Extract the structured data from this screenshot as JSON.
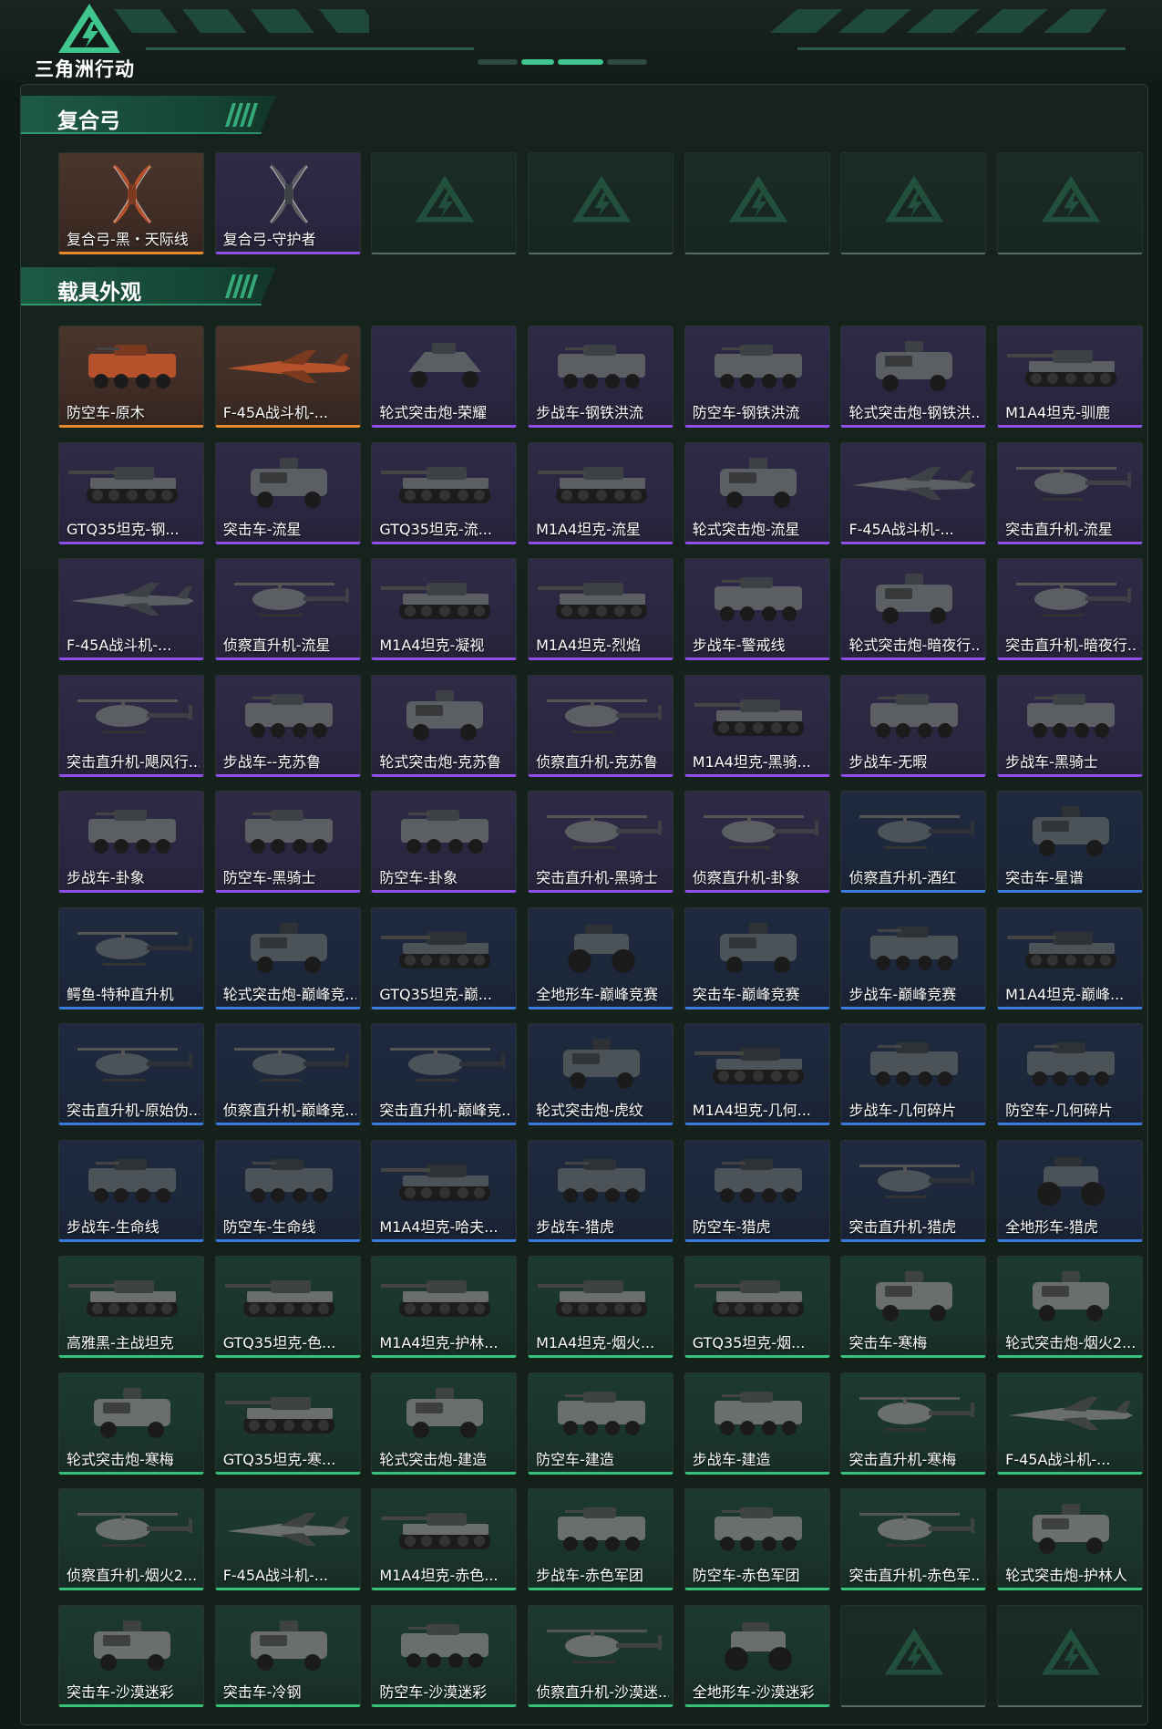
{
  "header": {
    "logo_text": "三角洲行动",
    "accent": "#3fc58d"
  },
  "sections": [
    {
      "title": "复合弓",
      "items": [
        {
          "name": "复合弓-黑・天际线",
          "rarity": "orange",
          "kind": "bow"
        },
        {
          "name": "复合弓-守护者",
          "rarity": "purple",
          "kind": "bow"
        },
        {
          "name": "",
          "rarity": "empty",
          "kind": "empty"
        },
        {
          "name": "",
          "rarity": "empty",
          "kind": "empty"
        },
        {
          "name": "",
          "rarity": "empty",
          "kind": "empty"
        },
        {
          "name": "",
          "rarity": "empty",
          "kind": "empty"
        },
        {
          "name": "",
          "rarity": "empty",
          "kind": "empty"
        }
      ]
    },
    {
      "title": "载具外观",
      "items": [
        {
          "name": "防空车-原木",
          "rarity": "orange",
          "kind": "apc"
        },
        {
          "name": "F-45A战斗机-...",
          "rarity": "orange",
          "kind": "jet"
        },
        {
          "name": "轮式突击炮-荣耀",
          "rarity": "purple",
          "kind": "buggy"
        },
        {
          "name": "步战车-钢铁洪流",
          "rarity": "purple",
          "kind": "apc"
        },
        {
          "name": "防空车-钢铁洪流",
          "rarity": "purple",
          "kind": "apc"
        },
        {
          "name": "轮式突击炮-钢铁洪...",
          "rarity": "purple",
          "kind": "truck"
        },
        {
          "name": "M1A4坦克-驯鹿",
          "rarity": "purple",
          "kind": "tank"
        },
        {
          "name": "GTQ35坦克-钢...",
          "rarity": "purple",
          "kind": "tank"
        },
        {
          "name": "突击车-流星",
          "rarity": "purple",
          "kind": "truck"
        },
        {
          "name": "GTQ35坦克-流...",
          "rarity": "purple",
          "kind": "tank"
        },
        {
          "name": "M1A4坦克-流星",
          "rarity": "purple",
          "kind": "tank"
        },
        {
          "name": "轮式突击炮-流星",
          "rarity": "purple",
          "kind": "truck"
        },
        {
          "name": "F-45A战斗机-...",
          "rarity": "purple",
          "kind": "jet"
        },
        {
          "name": "突击直升机-流星",
          "rarity": "purple",
          "kind": "heli"
        },
        {
          "name": "F-45A战斗机-...",
          "rarity": "purple",
          "kind": "jet"
        },
        {
          "name": "侦察直升机-流星",
          "rarity": "purple",
          "kind": "heli"
        },
        {
          "name": "M1A4坦克-凝视",
          "rarity": "purple",
          "kind": "tank"
        },
        {
          "name": "M1A4坦克-烈焰",
          "rarity": "purple",
          "kind": "tank"
        },
        {
          "name": "步战车-警戒线",
          "rarity": "purple",
          "kind": "apc"
        },
        {
          "name": "轮式突击炮-暗夜行...",
          "rarity": "purple",
          "kind": "truck"
        },
        {
          "name": "突击直升机-暗夜行...",
          "rarity": "purple",
          "kind": "heli"
        },
        {
          "name": "突击直升机-飓风行...",
          "rarity": "purple",
          "kind": "heli"
        },
        {
          "name": "步战车--克苏鲁",
          "rarity": "purple",
          "kind": "apc"
        },
        {
          "name": "轮式突击炮-克苏鲁",
          "rarity": "purple",
          "kind": "truck"
        },
        {
          "name": "侦察直升机-克苏鲁",
          "rarity": "purple",
          "kind": "heli"
        },
        {
          "name": "M1A4坦克-黑骑...",
          "rarity": "purple",
          "kind": "tank"
        },
        {
          "name": "步战车-无暇",
          "rarity": "purple",
          "kind": "apc"
        },
        {
          "name": "步战车-黑骑士",
          "rarity": "purple",
          "kind": "apc"
        },
        {
          "name": "步战车-卦象",
          "rarity": "purple",
          "kind": "apc"
        },
        {
          "name": "防空车-黑骑士",
          "rarity": "purple",
          "kind": "apc"
        },
        {
          "name": "防空车-卦象",
          "rarity": "purple",
          "kind": "apc"
        },
        {
          "name": "突击直升机-黑骑士",
          "rarity": "purple",
          "kind": "heli"
        },
        {
          "name": "侦察直升机-卦象",
          "rarity": "purple",
          "kind": "heli"
        },
        {
          "name": "侦察直升机-酒红",
          "rarity": "blue",
          "kind": "heli"
        },
        {
          "name": "突击车-星谱",
          "rarity": "blue",
          "kind": "truck"
        },
        {
          "name": "鳄鱼-特种直升机",
          "rarity": "blue",
          "kind": "heli"
        },
        {
          "name": "轮式突击炮-巅峰竞...",
          "rarity": "blue",
          "kind": "truck"
        },
        {
          "name": "GTQ35坦克-巅...",
          "rarity": "blue",
          "kind": "tank"
        },
        {
          "name": "全地形车-巅峰竞赛",
          "rarity": "blue",
          "kind": "atv"
        },
        {
          "name": "突击车-巅峰竞赛",
          "rarity": "blue",
          "kind": "truck"
        },
        {
          "name": "步战车-巅峰竞赛",
          "rarity": "blue",
          "kind": "apc"
        },
        {
          "name": "M1A4坦克-巅峰...",
          "rarity": "blue",
          "kind": "tank"
        },
        {
          "name": "突击直升机-原始伪...",
          "rarity": "blue",
          "kind": "heli"
        },
        {
          "name": "侦察直升机-巅峰竞...",
          "rarity": "blue",
          "kind": "heli"
        },
        {
          "name": "突击直升机-巅峰竞...",
          "rarity": "blue",
          "kind": "heli"
        },
        {
          "name": "轮式突击炮-虎纹",
          "rarity": "blue",
          "kind": "truck"
        },
        {
          "name": "M1A4坦克-几何...",
          "rarity": "blue",
          "kind": "tank"
        },
        {
          "name": "步战车-几何碎片",
          "rarity": "blue",
          "kind": "apc"
        },
        {
          "name": "防空车-几何碎片",
          "rarity": "blue",
          "kind": "apc"
        },
        {
          "name": "步战车-生命线",
          "rarity": "blue",
          "kind": "apc"
        },
        {
          "name": "防空车-生命线",
          "rarity": "blue",
          "kind": "apc"
        },
        {
          "name": "M1A4坦克-哈夫...",
          "rarity": "blue",
          "kind": "tank"
        },
        {
          "name": "步战车-猎虎",
          "rarity": "blue",
          "kind": "apc"
        },
        {
          "name": "防空车-猎虎",
          "rarity": "blue",
          "kind": "apc"
        },
        {
          "name": "突击直升机-猎虎",
          "rarity": "blue",
          "kind": "heli"
        },
        {
          "name": "全地形车-猎虎",
          "rarity": "blue",
          "kind": "atv"
        },
        {
          "name": "高雅黑-主战坦克",
          "rarity": "green",
          "kind": "tank"
        },
        {
          "name": "GTQ35坦克-色...",
          "rarity": "green",
          "kind": "tank"
        },
        {
          "name": "M1A4坦克-护林...",
          "rarity": "green",
          "kind": "tank"
        },
        {
          "name": "M1A4坦克-烟火...",
          "rarity": "green",
          "kind": "tank"
        },
        {
          "name": "GTQ35坦克-烟...",
          "rarity": "green",
          "kind": "tank"
        },
        {
          "name": "突击车-寒梅",
          "rarity": "green",
          "kind": "truck"
        },
        {
          "name": "轮式突击炮-烟火2...",
          "rarity": "green",
          "kind": "truck"
        },
        {
          "name": "轮式突击炮-寒梅",
          "rarity": "green",
          "kind": "truck"
        },
        {
          "name": "GTQ35坦克-寒...",
          "rarity": "green",
          "kind": "tank"
        },
        {
          "name": "轮式突击炮-建造",
          "rarity": "green",
          "kind": "truck"
        },
        {
          "name": "防空车-建造",
          "rarity": "green",
          "kind": "apc"
        },
        {
          "name": "步战车-建造",
          "rarity": "green",
          "kind": "apc"
        },
        {
          "name": "突击直升机-寒梅",
          "rarity": "green",
          "kind": "heli"
        },
        {
          "name": "F-45A战斗机-...",
          "rarity": "green",
          "kind": "jet"
        },
        {
          "name": "侦察直升机-烟火2...",
          "rarity": "green",
          "kind": "heli"
        },
        {
          "name": "F-45A战斗机-...",
          "rarity": "green",
          "kind": "jet"
        },
        {
          "name": "M1A4坦克-赤色...",
          "rarity": "green",
          "kind": "tank"
        },
        {
          "name": "步战车-赤色军团",
          "rarity": "green",
          "kind": "apc"
        },
        {
          "name": "防空车-赤色军团",
          "rarity": "green",
          "kind": "apc"
        },
        {
          "name": "突击直升机-赤色军...",
          "rarity": "green",
          "kind": "heli"
        },
        {
          "name": "轮式突击炮-护林人",
          "rarity": "green",
          "kind": "truck"
        },
        {
          "name": "突击车-沙漠迷彩",
          "rarity": "green",
          "kind": "truck"
        },
        {
          "name": "突击车-冷钢",
          "rarity": "green",
          "kind": "truck"
        },
        {
          "name": "防空车-沙漠迷彩",
          "rarity": "green",
          "kind": "apc"
        },
        {
          "name": "侦察直升机-沙漠迷...",
          "rarity": "green",
          "kind": "heli"
        },
        {
          "name": "全地形车-沙漠迷彩",
          "rarity": "green",
          "kind": "atv"
        },
        {
          "name": "",
          "rarity": "empty",
          "kind": "empty"
        },
        {
          "name": "",
          "rarity": "empty",
          "kind": "empty"
        }
      ]
    }
  ],
  "colors": {
    "purple": "#8d4fe8",
    "orange": "#e88a2d",
    "blue": "#3a7be0",
    "green": "#35c27b"
  }
}
